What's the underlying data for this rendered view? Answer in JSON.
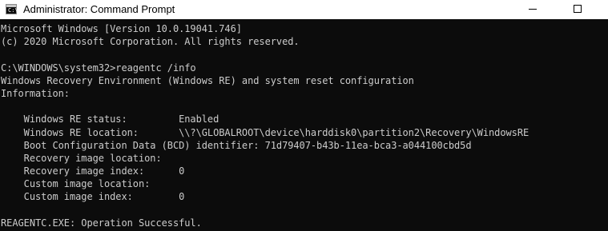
{
  "window": {
    "title": "Administrator: Command Prompt",
    "icon": "cmd-icon",
    "icon_glyph": "C:\\",
    "controls": [
      "minimize-icon",
      "maximize-icon"
    ]
  },
  "colors": {
    "console_background": "#0c0c0c",
    "console_text": "#cccccc",
    "titlebar_background": "#ffffff"
  },
  "console": {
    "lines": [
      "Microsoft Windows [Version 10.0.19041.746]",
      "(c) 2020 Microsoft Corporation. All rights reserved.",
      "",
      "C:\\WINDOWS\\system32>reagentc /info",
      "Windows Recovery Environment (Windows RE) and system reset configuration",
      "Information:",
      "",
      "    Windows RE status:         Enabled",
      "    Windows RE location:       \\\\?\\GLOBALROOT\\device\\harddisk0\\partition2\\Recovery\\WindowsRE",
      "    Boot Configuration Data (BCD) identifier: 71d79407-b43b-11ea-bca3-a044100cbd5d",
      "    Recovery image location:",
      "    Recovery image index:      0",
      "    Custom image location:",
      "    Custom image index:        0",
      "",
      "REAGENTC.EXE: Operation Successful."
    ]
  }
}
